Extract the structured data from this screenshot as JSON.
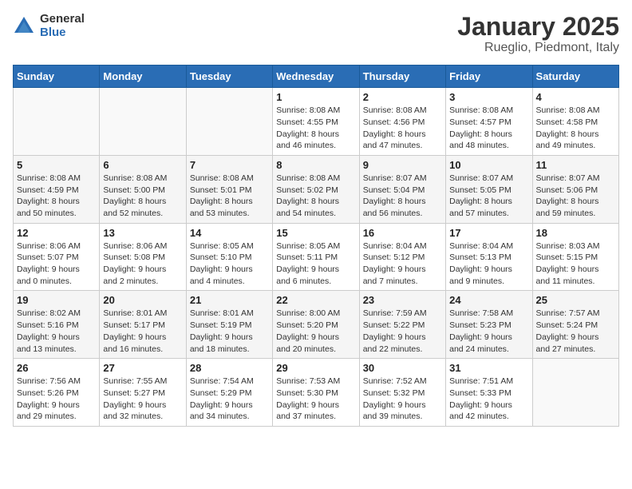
{
  "logo": {
    "general": "General",
    "blue": "Blue"
  },
  "title": "January 2025",
  "subtitle": "Rueglio, Piedmont, Italy",
  "days_header": [
    "Sunday",
    "Monday",
    "Tuesday",
    "Wednesday",
    "Thursday",
    "Friday",
    "Saturday"
  ],
  "weeks": [
    [
      {
        "day": "",
        "info": ""
      },
      {
        "day": "",
        "info": ""
      },
      {
        "day": "",
        "info": ""
      },
      {
        "day": "1",
        "info": "Sunrise: 8:08 AM\nSunset: 4:55 PM\nDaylight: 8 hours\nand 46 minutes."
      },
      {
        "day": "2",
        "info": "Sunrise: 8:08 AM\nSunset: 4:56 PM\nDaylight: 8 hours\nand 47 minutes."
      },
      {
        "day": "3",
        "info": "Sunrise: 8:08 AM\nSunset: 4:57 PM\nDaylight: 8 hours\nand 48 minutes."
      },
      {
        "day": "4",
        "info": "Sunrise: 8:08 AM\nSunset: 4:58 PM\nDaylight: 8 hours\nand 49 minutes."
      }
    ],
    [
      {
        "day": "5",
        "info": "Sunrise: 8:08 AM\nSunset: 4:59 PM\nDaylight: 8 hours\nand 50 minutes."
      },
      {
        "day": "6",
        "info": "Sunrise: 8:08 AM\nSunset: 5:00 PM\nDaylight: 8 hours\nand 52 minutes."
      },
      {
        "day": "7",
        "info": "Sunrise: 8:08 AM\nSunset: 5:01 PM\nDaylight: 8 hours\nand 53 minutes."
      },
      {
        "day": "8",
        "info": "Sunrise: 8:08 AM\nSunset: 5:02 PM\nDaylight: 8 hours\nand 54 minutes."
      },
      {
        "day": "9",
        "info": "Sunrise: 8:07 AM\nSunset: 5:04 PM\nDaylight: 8 hours\nand 56 minutes."
      },
      {
        "day": "10",
        "info": "Sunrise: 8:07 AM\nSunset: 5:05 PM\nDaylight: 8 hours\nand 57 minutes."
      },
      {
        "day": "11",
        "info": "Sunrise: 8:07 AM\nSunset: 5:06 PM\nDaylight: 8 hours\nand 59 minutes."
      }
    ],
    [
      {
        "day": "12",
        "info": "Sunrise: 8:06 AM\nSunset: 5:07 PM\nDaylight: 9 hours\nand 0 minutes."
      },
      {
        "day": "13",
        "info": "Sunrise: 8:06 AM\nSunset: 5:08 PM\nDaylight: 9 hours\nand 2 minutes."
      },
      {
        "day": "14",
        "info": "Sunrise: 8:05 AM\nSunset: 5:10 PM\nDaylight: 9 hours\nand 4 minutes."
      },
      {
        "day": "15",
        "info": "Sunrise: 8:05 AM\nSunset: 5:11 PM\nDaylight: 9 hours\nand 6 minutes."
      },
      {
        "day": "16",
        "info": "Sunrise: 8:04 AM\nSunset: 5:12 PM\nDaylight: 9 hours\nand 7 minutes."
      },
      {
        "day": "17",
        "info": "Sunrise: 8:04 AM\nSunset: 5:13 PM\nDaylight: 9 hours\nand 9 minutes."
      },
      {
        "day": "18",
        "info": "Sunrise: 8:03 AM\nSunset: 5:15 PM\nDaylight: 9 hours\nand 11 minutes."
      }
    ],
    [
      {
        "day": "19",
        "info": "Sunrise: 8:02 AM\nSunset: 5:16 PM\nDaylight: 9 hours\nand 13 minutes."
      },
      {
        "day": "20",
        "info": "Sunrise: 8:01 AM\nSunset: 5:17 PM\nDaylight: 9 hours\nand 16 minutes."
      },
      {
        "day": "21",
        "info": "Sunrise: 8:01 AM\nSunset: 5:19 PM\nDaylight: 9 hours\nand 18 minutes."
      },
      {
        "day": "22",
        "info": "Sunrise: 8:00 AM\nSunset: 5:20 PM\nDaylight: 9 hours\nand 20 minutes."
      },
      {
        "day": "23",
        "info": "Sunrise: 7:59 AM\nSunset: 5:22 PM\nDaylight: 9 hours\nand 22 minutes."
      },
      {
        "day": "24",
        "info": "Sunrise: 7:58 AM\nSunset: 5:23 PM\nDaylight: 9 hours\nand 24 minutes."
      },
      {
        "day": "25",
        "info": "Sunrise: 7:57 AM\nSunset: 5:24 PM\nDaylight: 9 hours\nand 27 minutes."
      }
    ],
    [
      {
        "day": "26",
        "info": "Sunrise: 7:56 AM\nSunset: 5:26 PM\nDaylight: 9 hours\nand 29 minutes."
      },
      {
        "day": "27",
        "info": "Sunrise: 7:55 AM\nSunset: 5:27 PM\nDaylight: 9 hours\nand 32 minutes."
      },
      {
        "day": "28",
        "info": "Sunrise: 7:54 AM\nSunset: 5:29 PM\nDaylight: 9 hours\nand 34 minutes."
      },
      {
        "day": "29",
        "info": "Sunrise: 7:53 AM\nSunset: 5:30 PM\nDaylight: 9 hours\nand 37 minutes."
      },
      {
        "day": "30",
        "info": "Sunrise: 7:52 AM\nSunset: 5:32 PM\nDaylight: 9 hours\nand 39 minutes."
      },
      {
        "day": "31",
        "info": "Sunrise: 7:51 AM\nSunset: 5:33 PM\nDaylight: 9 hours\nand 42 minutes."
      },
      {
        "day": "",
        "info": ""
      }
    ]
  ]
}
